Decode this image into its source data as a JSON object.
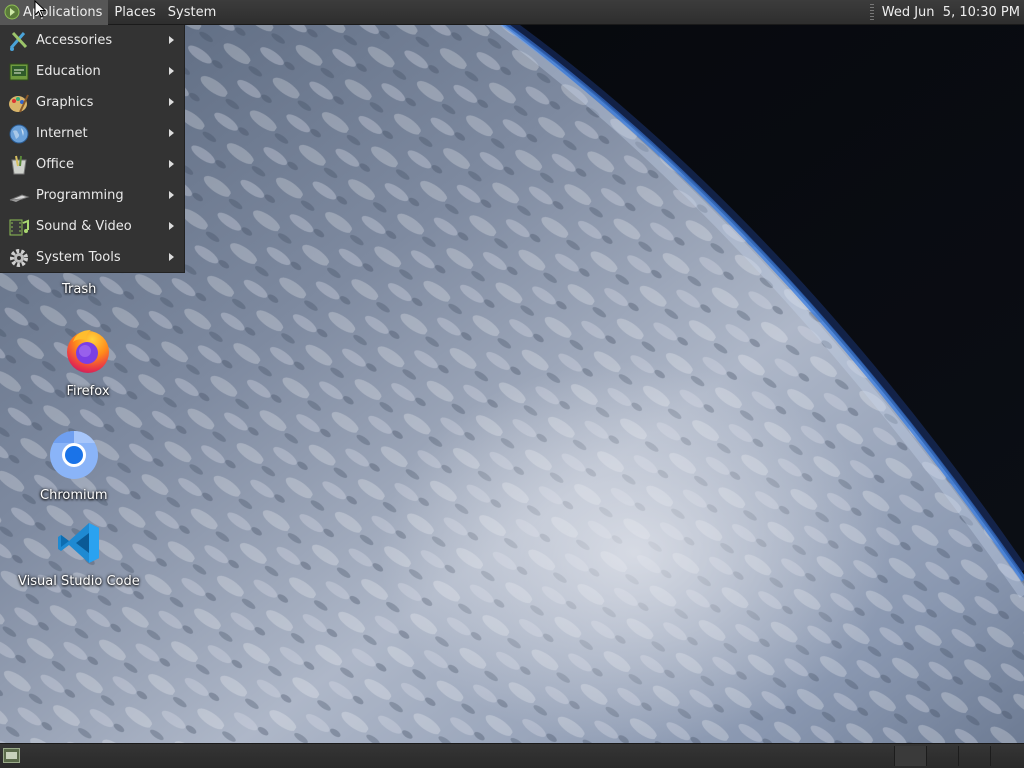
{
  "top_panel": {
    "menus": [
      {
        "label": "Applications",
        "active": true
      },
      {
        "label": "Places"
      },
      {
        "label": "System"
      }
    ],
    "clock": "Wed Jun  5, 10:30 PM"
  },
  "applications_menu": {
    "items": [
      {
        "label": "Accessories",
        "icon": "accessories-icon"
      },
      {
        "label": "Education",
        "icon": "education-icon"
      },
      {
        "label": "Graphics",
        "icon": "graphics-icon"
      },
      {
        "label": "Internet",
        "icon": "internet-icon"
      },
      {
        "label": "Office",
        "icon": "office-icon"
      },
      {
        "label": "Programming",
        "icon": "programming-icon"
      },
      {
        "label": "Sound & Video",
        "icon": "sound-video-icon"
      },
      {
        "label": "System Tools",
        "icon": "system-tools-icon"
      }
    ]
  },
  "desktop": {
    "icons": [
      {
        "label": "Trash",
        "icon": "trash-icon"
      },
      {
        "label": "Firefox",
        "icon": "firefox-icon"
      },
      {
        "label": "Chromium",
        "icon": "chromium-icon"
      },
      {
        "label": "Visual Studio Code",
        "icon": "vscode-icon"
      }
    ]
  },
  "colors": {
    "panel": "#2e2e2e",
    "menu_bg": "#333333",
    "active_menu": "#565656"
  }
}
